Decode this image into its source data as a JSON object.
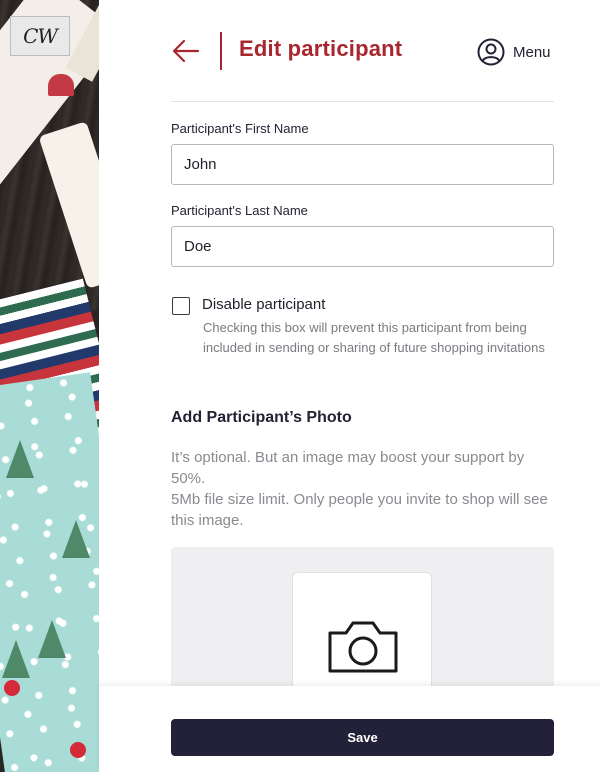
{
  "branding": {
    "logo_text": "CW"
  },
  "header": {
    "title": "Edit participant",
    "menu_label": "Menu",
    "back_icon": "arrow-left-icon",
    "menu_icon": "user-circle-icon",
    "accent_color": "#a8262e"
  },
  "form": {
    "first_name": {
      "label": "Participant's First Name",
      "value": "John"
    },
    "last_name": {
      "label": "Participant's Last Name",
      "value": "Doe"
    },
    "disable": {
      "label": "Disable participant",
      "checked": false,
      "help": "Checking this box will prevent this participant from being included in sending or sharing of future shopping invitations"
    }
  },
  "photo": {
    "title": "Add Participant’s Photo",
    "help_1": "It’s optional. But an image may boost your support by 50%.",
    "help_2": "5Mb file size limit. Only people you invite to shop will see this image.",
    "upload_icon": "camera-icon"
  },
  "footer": {
    "save_label": "Save",
    "button_color": "#23213a"
  }
}
